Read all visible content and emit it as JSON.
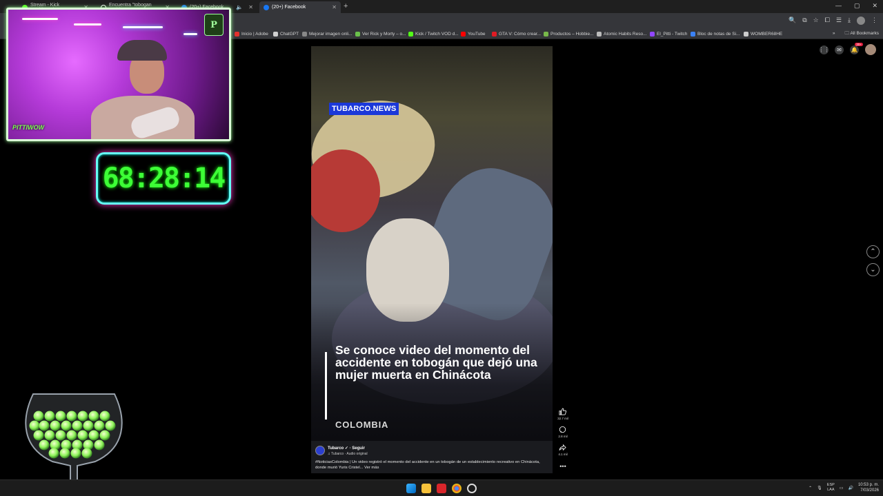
{
  "browser": {
    "tabs": [
      {
        "label": "Stream - Kick Dashboard"
      },
      {
        "label": "Encuentra \"tobogan accidente"
      },
      {
        "label": "(20+) Facebook"
      },
      {
        "label": "(20+) Facebook"
      }
    ],
    "bookmarks": [
      {
        "label": "Inicio | Adobe",
        "color": "#e3312d"
      },
      {
        "label": "ChatGPT",
        "color": "#d0d0d0"
      },
      {
        "label": "Mejorar imagen onli...",
        "color": "#888888"
      },
      {
        "label": "Ver Rick y Morty – o...",
        "color": "#6ac14b"
      },
      {
        "label": "Kick / Twitch VOD d...",
        "color": "#53fc18"
      },
      {
        "label": "YouTube",
        "color": "#ff0000"
      },
      {
        "label": "GTA V: Cómo crear...",
        "color": "#e01b24"
      },
      {
        "label": "Productos – Hobbie...",
        "color": "#78b84a"
      },
      {
        "label": "Atomic Habits Reso...",
        "color": "#bbbbbb"
      },
      {
        "label": "El_Pitti - Twitch",
        "color": "#9146ff"
      },
      {
        "label": "Bloc de notas de Si...",
        "color": "#3b82f6"
      },
      {
        "label": "WOMBER68HE",
        "color": "#cccccc"
      }
    ],
    "all_bookmarks": "All Bookmarks"
  },
  "overlay": {
    "timer": "68:28:14",
    "webcam_logo": "PITTIWOW",
    "webcam_badge": "P"
  },
  "reel": {
    "brand": "TUBARCO.NEWS",
    "headline": "Se conoce video del momento del accidente en tobogán que dejó una mujer muerta en Chinácota",
    "section": "COLOMBIA",
    "page_name": "Tubarco ✓ · Seguir",
    "audio": "♫ Tubarco · Audio original",
    "caption": "#NoticiasColombia | Un video registró el momento del accidente en un tobogán de un establecimiento recreativo en Chinácota, donde murió Yuris Cristel... Ver más",
    "likes": "32.7 mil",
    "comments": "2.8 mil",
    "shares": "4.1 mil",
    "more": "•••"
  },
  "facebook": {
    "notifications_badge": "20+"
  },
  "taskbar": {
    "lang_top": "ESP",
    "lang_bottom": "LAA",
    "time": "10:53 p. m.",
    "date": "7/03/2026"
  }
}
